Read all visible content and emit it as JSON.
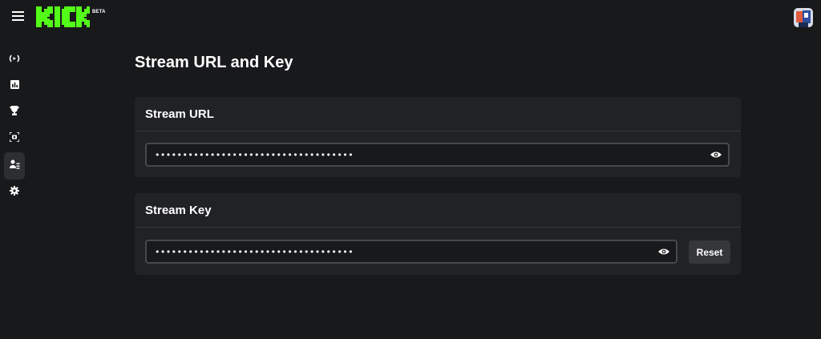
{
  "app": {
    "logo_text": "KICK",
    "beta_label": "BETA",
    "brand_color": "#53fc18"
  },
  "topbar": {
    "menu_icon": "hamburger-menu-icon",
    "avatar": "user-avatar"
  },
  "sidebar": {
    "items": [
      {
        "icon": "broadcast-icon",
        "name": "stream"
      },
      {
        "icon": "analytics-icon",
        "name": "analytics"
      },
      {
        "icon": "trophy-icon",
        "name": "achievements"
      },
      {
        "icon": "screen-capture-icon",
        "name": "capture"
      },
      {
        "icon": "user-settings-icon",
        "name": "account",
        "active": true
      },
      {
        "icon": "gear-icon",
        "name": "settings"
      }
    ]
  },
  "page": {
    "title": "Stream URL and Key"
  },
  "stream_url": {
    "label": "Stream URL",
    "value": "••••••••••••••••••••••••••••••••••••"
  },
  "stream_key": {
    "label": "Stream Key",
    "value": "••••••••••••••••••••••••••••••••••••",
    "reset_label": "Reset"
  }
}
